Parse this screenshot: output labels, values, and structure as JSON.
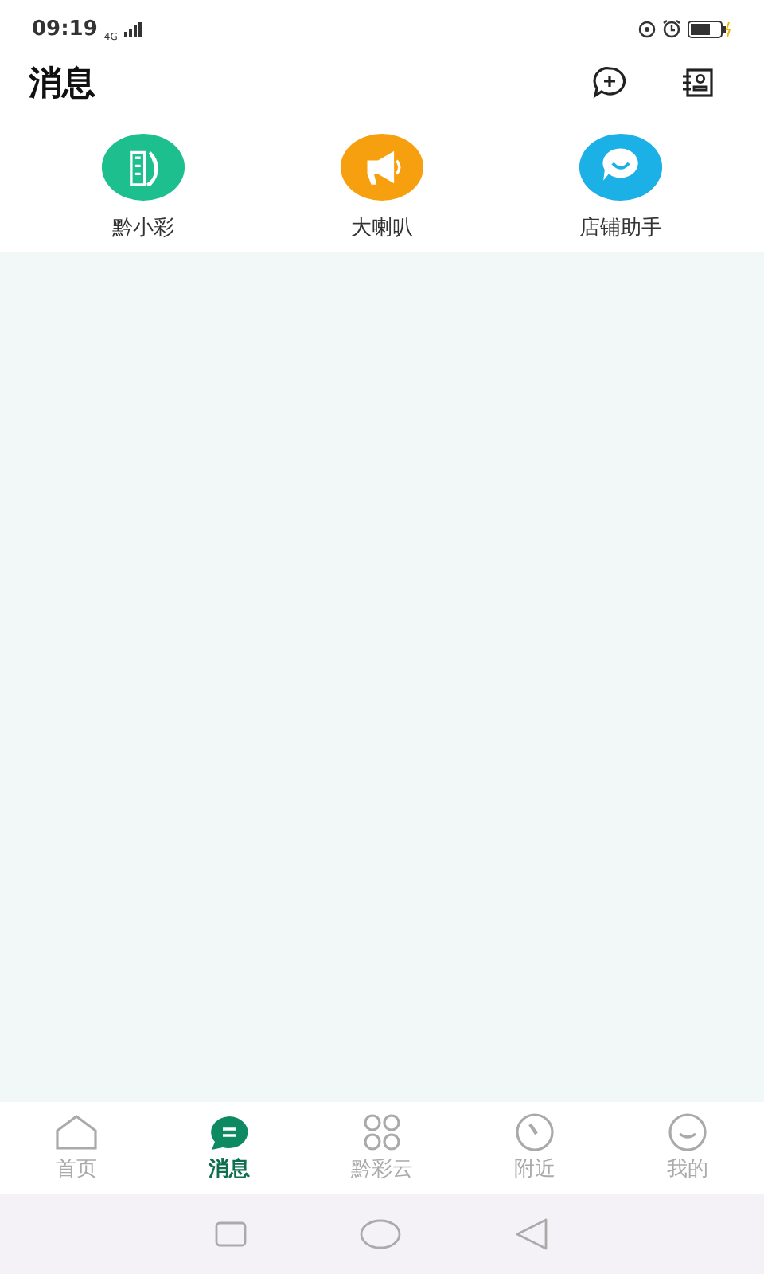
{
  "status_bar": {
    "time": "09:19",
    "network": "4G"
  },
  "header": {
    "title": "消息"
  },
  "shortcuts": [
    {
      "label": "黔小彩",
      "kind": "logo",
      "color": "#1dbf8e"
    },
    {
      "label": "大喇叭",
      "kind": "megaphone",
      "color": "#f7a00f"
    },
    {
      "label": "店铺助手",
      "kind": "chat",
      "color": "#1bb0e6"
    }
  ],
  "tabs": [
    {
      "label": "首页",
      "kind": "home",
      "selected": false
    },
    {
      "label": "消息",
      "kind": "message",
      "selected": true
    },
    {
      "label": "黔彩云",
      "kind": "grid",
      "selected": false
    },
    {
      "label": "附近",
      "kind": "compass",
      "selected": false
    },
    {
      "label": "我的",
      "kind": "smile",
      "selected": false
    }
  ]
}
